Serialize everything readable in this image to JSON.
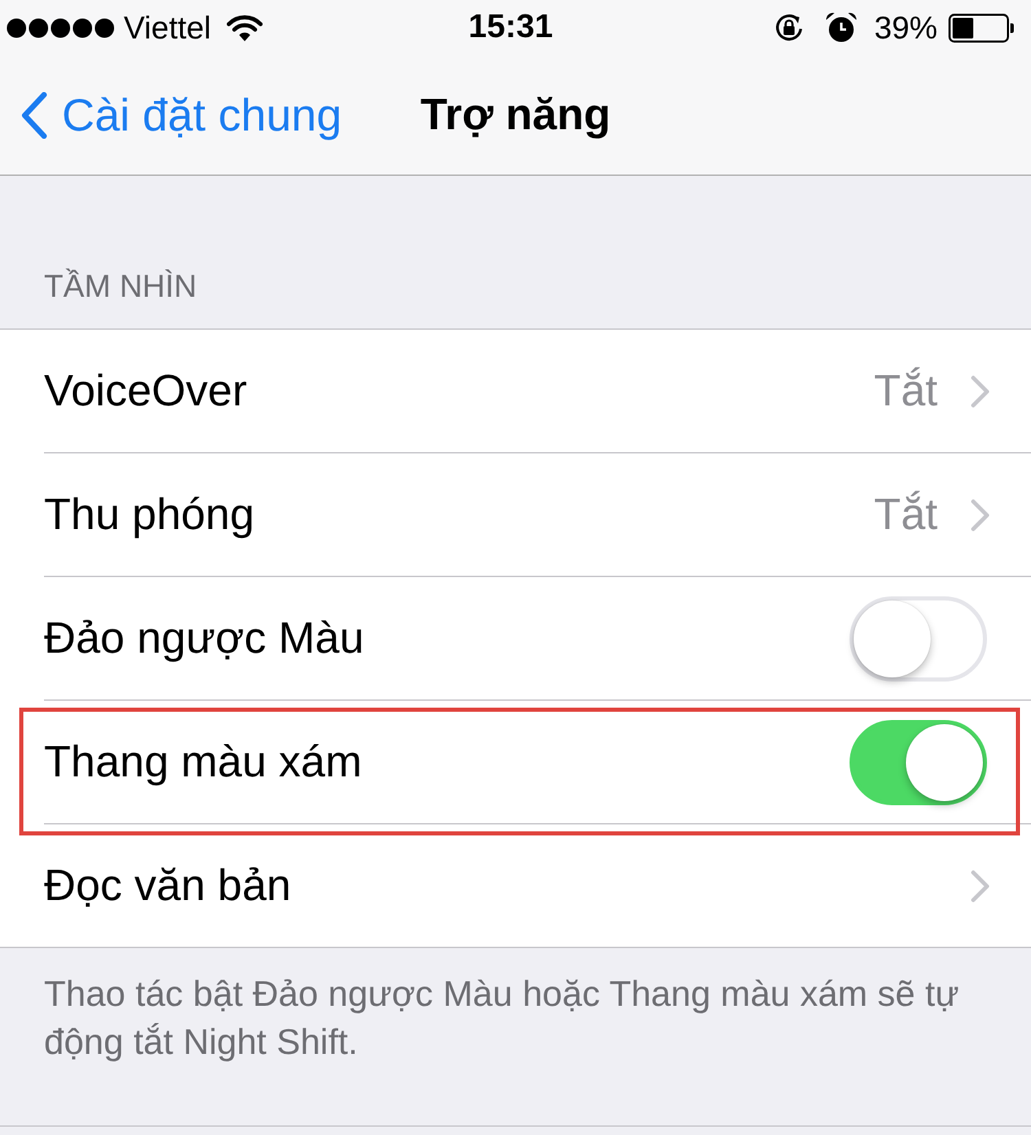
{
  "status_bar": {
    "carrier": "Viettel",
    "time": "15:31",
    "battery": "39%"
  },
  "nav_bar": {
    "back_label": "Cài đặt chung",
    "title": "Trợ năng"
  },
  "sections": [
    {
      "header": "TẦM NHÌN",
      "rows": [
        {
          "kind": "link",
          "label": "VoiceOver",
          "value": "Tắt",
          "highlighted": false
        },
        {
          "kind": "link",
          "label": "Thu phóng",
          "value": "Tắt",
          "highlighted": false
        },
        {
          "kind": "toggle",
          "label": "Đảo ngược Màu",
          "on": false,
          "highlighted": false
        },
        {
          "kind": "toggle",
          "label": "Thang màu xám",
          "on": true,
          "highlighted": true
        },
        {
          "kind": "link",
          "label": "Đọc văn bản",
          "highlighted": false
        }
      ],
      "footer": "Thao tác bật Đảo ngược Màu hoặc Thang màu xám sẽ tự động tắt Night Shift."
    }
  ]
}
